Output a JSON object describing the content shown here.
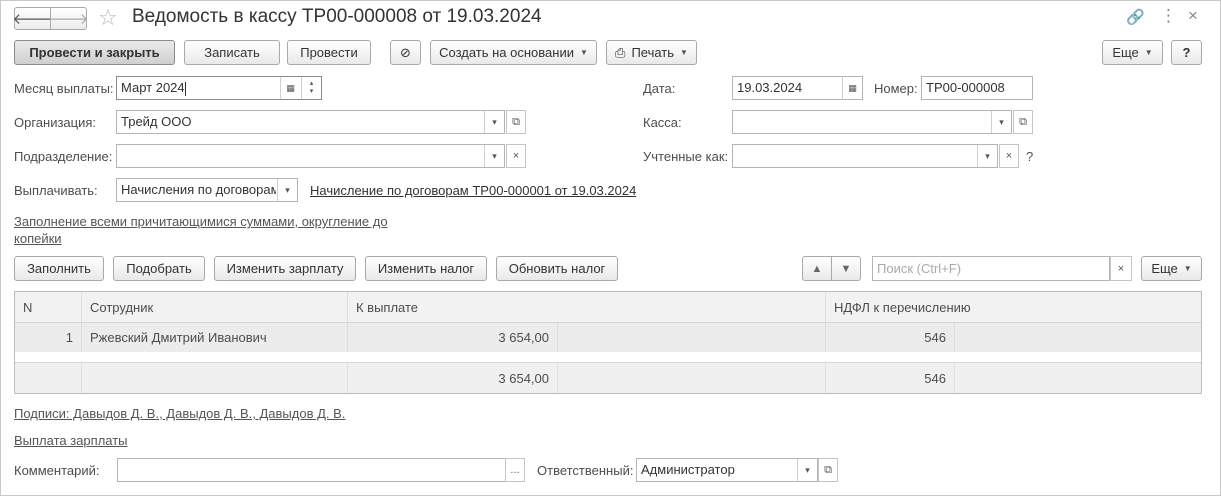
{
  "title": "Ведомость в кассу ТР00-000008 от 19.03.2024",
  "nav": {
    "back": "🡐",
    "forward": "🡒"
  },
  "icons": {
    "star": "☆",
    "link": "🔗",
    "menu": "⋮",
    "close": "×",
    "calendar": "▦",
    "dropdown": "▾",
    "open": "⧉",
    "clear": "×",
    "up": "▲",
    "down": "▼",
    "paperclip": "⊘",
    "printer": "⎙"
  },
  "toolbar": {
    "post_close": "Провести и закрыть",
    "save": "Записать",
    "post": "Провести",
    "create_based": "Создать на основании",
    "print": "Печать",
    "more": "Еще",
    "help": "?"
  },
  "form": {
    "month_label": "Месяц выплаты:",
    "month_value": "Март 2024",
    "date_label": "Дата:",
    "date_value": "19.03.2024",
    "number_label": "Номер:",
    "number_value": "ТР00-000008",
    "org_label": "Организация:",
    "org_value": "Трейд ООО",
    "cash_label": "Касса:",
    "cash_value": "",
    "dept_label": "Подразделение:",
    "dept_value": "",
    "counted_label": "Учтенные как:",
    "counted_value": "",
    "counted_help": "?",
    "pay_label": "Выплачивать:",
    "pay_value": "Начисления по договорам",
    "pay_link": "Начисление по договорам ТР00-000001 от 19.03.2024",
    "fill_link_1": "Заполнение всеми причитающимися суммами, округление до",
    "fill_link_2": "копейки"
  },
  "table_toolbar": {
    "fill": "Заполнить",
    "pick": "Подобрать",
    "change_salary": "Изменить зарплату",
    "change_tax": "Изменить налог",
    "update_tax": "Обновить налог",
    "search_placeholder": "Поиск (Ctrl+F)",
    "more": "Еще"
  },
  "table": {
    "headers": [
      "N",
      "Сотрудник",
      "К выплате",
      "НДФЛ к перечислению"
    ],
    "rows": [
      {
        "n": "1",
        "employee": "Ржевский Дмитрий Иванович",
        "pay": "3 654,00",
        "tax": "546"
      }
    ],
    "totals": {
      "pay": "3 654,00",
      "tax": "546"
    }
  },
  "bottom": {
    "signatures": "Подписи: Давыдов Д. В., Давыдов Д. В., Давыдов Д. В.",
    "salary_payment": "Выплата зарплаты",
    "comment_label": "Комментарий:",
    "comment_value": "",
    "comment_btn": "...",
    "responsible_label": "Ответственный:",
    "responsible_value": "Администратор"
  }
}
